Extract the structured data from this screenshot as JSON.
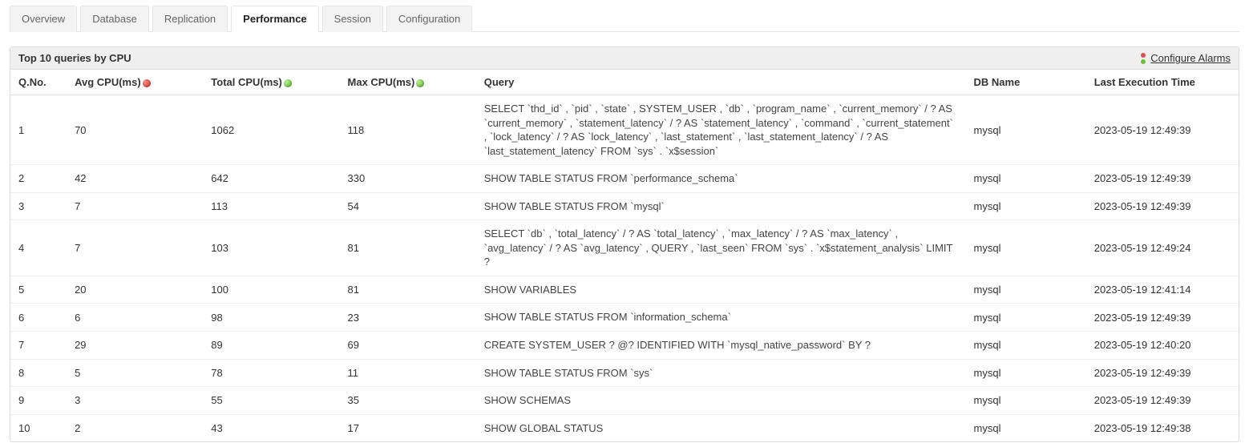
{
  "tabs": [
    {
      "label": "Overview",
      "active": false
    },
    {
      "label": "Database",
      "active": false
    },
    {
      "label": "Replication",
      "active": false
    },
    {
      "label": "Performance",
      "active": true
    },
    {
      "label": "Session",
      "active": false
    },
    {
      "label": "Configuration",
      "active": false
    }
  ],
  "panel": {
    "title": "Top 10 queries by CPU",
    "configure_label": "Configure Alarms"
  },
  "columns": {
    "qno": "Q.No.",
    "avg": "Avg CPU(ms)",
    "total": "Total CPU(ms)",
    "max": "Max CPU(ms)",
    "query": "Query",
    "db": "DB Name",
    "time": "Last Execution Time"
  },
  "status_dots": {
    "avg": "red",
    "total": "green",
    "max": "green"
  },
  "rows": [
    {
      "qno": "1",
      "avg": "70",
      "total": "1062",
      "max": "118",
      "query": "SELECT `thd_id` , `pid` , `state` , SYSTEM_USER , `db` , `program_name` , `current_memory` / ? AS `current_memory` , `statement_latency` / ? AS `statement_latency` , `command` , `current_statement` , `lock_latency` / ? AS `lock_latency` , `last_statement` , `last_statement_latency` / ? AS `last_statement_latency` FROM `sys` . `x$session`",
      "db": "mysql",
      "time": "2023-05-19 12:49:39"
    },
    {
      "qno": "2",
      "avg": "42",
      "total": "642",
      "max": "330",
      "query": "SHOW TABLE STATUS FROM `performance_schema`",
      "db": "mysql",
      "time": "2023-05-19 12:49:39"
    },
    {
      "qno": "3",
      "avg": "7",
      "total": "113",
      "max": "54",
      "query": "SHOW TABLE STATUS FROM `mysql`",
      "db": "mysql",
      "time": "2023-05-19 12:49:39"
    },
    {
      "qno": "4",
      "avg": "7",
      "total": "103",
      "max": "81",
      "query": "SELECT `db` , `total_latency` / ? AS `total_latency` , `max_latency` / ? AS `max_latency` , `avg_latency` / ? AS `avg_latency` , QUERY , `last_seen` FROM `sys` . `x$statement_analysis` LIMIT ?",
      "db": "mysql",
      "time": "2023-05-19 12:49:24"
    },
    {
      "qno": "5",
      "avg": "20",
      "total": "100",
      "max": "81",
      "query": "SHOW VARIABLES",
      "db": "mysql",
      "time": "2023-05-19 12:41:14"
    },
    {
      "qno": "6",
      "avg": "6",
      "total": "98",
      "max": "23",
      "query": "SHOW TABLE STATUS FROM `information_schema`",
      "db": "mysql",
      "time": "2023-05-19 12:49:39"
    },
    {
      "qno": "7",
      "avg": "29",
      "total": "89",
      "max": "69",
      "query": "CREATE SYSTEM_USER ? @? IDENTIFIED WITH `mysql_native_password` BY ?",
      "db": "mysql",
      "time": "2023-05-19 12:40:20"
    },
    {
      "qno": "8",
      "avg": "5",
      "total": "78",
      "max": "11",
      "query": "SHOW TABLE STATUS FROM `sys`",
      "db": "mysql",
      "time": "2023-05-19 12:49:39"
    },
    {
      "qno": "9",
      "avg": "3",
      "total": "55",
      "max": "35",
      "query": "SHOW SCHEMAS",
      "db": "mysql",
      "time": "2023-05-19 12:49:39"
    },
    {
      "qno": "10",
      "avg": "2",
      "total": "43",
      "max": "17",
      "query": "SHOW GLOBAL STATUS",
      "db": "mysql",
      "time": "2023-05-19 12:49:38"
    }
  ]
}
